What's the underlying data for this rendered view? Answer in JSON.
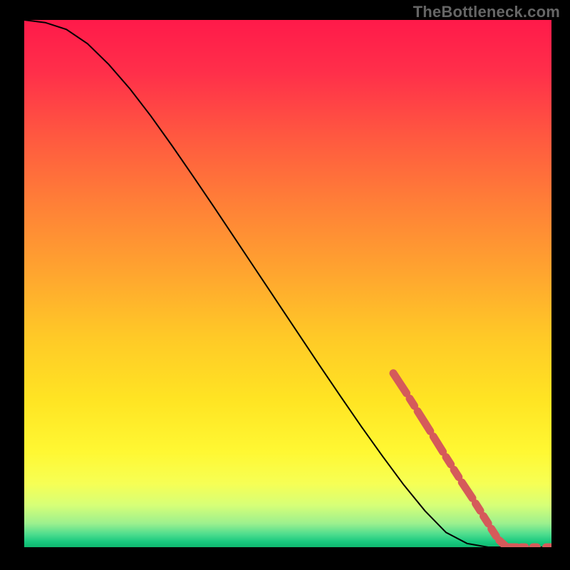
{
  "watermark": "TheBottleneck.com",
  "chart_data": {
    "type": "line",
    "title": "",
    "xlabel": "",
    "ylabel": "",
    "xlim": [
      0,
      100
    ],
    "ylim": [
      0,
      100
    ],
    "curve": {
      "description": "bottleneck curve, starts top-left, curves over, drops diagonally to bottom-right where it levels off",
      "x": [
        0,
        4,
        8,
        12,
        16,
        20,
        24,
        28,
        32,
        36,
        40,
        44,
        48,
        52,
        56,
        60,
        64,
        68,
        72,
        76,
        80,
        84,
        88,
        92,
        96,
        100
      ],
      "y": [
        100,
        99.5,
        98.2,
        95.5,
        91.6,
        87.0,
        81.8,
        76.2,
        70.4,
        64.5,
        58.5,
        52.5,
        46.5,
        40.5,
        34.5,
        28.6,
        22.8,
        17.2,
        11.8,
        6.9,
        2.8,
        0.7,
        0.0,
        0.0,
        0.0,
        0.0
      ]
    },
    "dash_segments": [
      {
        "x0": 70.0,
        "y0": 33.0,
        "x1": 72.5,
        "y1": 29.2
      },
      {
        "x0": 73.1,
        "y0": 28.2,
        "x1": 74.0,
        "y1": 26.8
      },
      {
        "x0": 74.6,
        "y0": 25.8,
        "x1": 77.0,
        "y1": 22.0
      },
      {
        "x0": 77.6,
        "y0": 21.0,
        "x1": 79.4,
        "y1": 18.1
      },
      {
        "x0": 80.0,
        "y0": 17.1,
        "x1": 80.9,
        "y1": 15.7
      },
      {
        "x0": 81.5,
        "y0": 14.7,
        "x1": 82.4,
        "y1": 13.3
      },
      {
        "x0": 83.0,
        "y0": 12.3,
        "x1": 85.0,
        "y1": 9.3
      },
      {
        "x0": 85.6,
        "y0": 8.3,
        "x1": 86.5,
        "y1": 6.9
      },
      {
        "x0": 87.1,
        "y0": 5.9,
        "x1": 88.0,
        "y1": 4.5
      },
      {
        "x0": 88.6,
        "y0": 3.5,
        "x1": 89.5,
        "y1": 2.1
      },
      {
        "x0": 90.1,
        "y0": 1.3,
        "x1": 91.3,
        "y1": 0.2
      },
      {
        "x0": 92.0,
        "y0": 0.0,
        "x1": 93.4,
        "y1": 0.0
      },
      {
        "x0": 94.3,
        "y0": 0.0,
        "x1": 95.0,
        "y1": 0.0
      },
      {
        "x0": 96.5,
        "y0": 0.0,
        "x1": 97.2,
        "y1": 0.0
      },
      {
        "x0": 99.0,
        "y0": 0.0,
        "x1": 100.0,
        "y1": 0.0
      }
    ],
    "gradient_stops": [
      {
        "offset": 0.0,
        "color": "#ff1a4a"
      },
      {
        "offset": 0.1,
        "color": "#ff2f4a"
      },
      {
        "offset": 0.22,
        "color": "#ff5840"
      },
      {
        "offset": 0.35,
        "color": "#ff8037"
      },
      {
        "offset": 0.48,
        "color": "#ffa52f"
      },
      {
        "offset": 0.6,
        "color": "#ffc927"
      },
      {
        "offset": 0.72,
        "color": "#ffe423"
      },
      {
        "offset": 0.82,
        "color": "#fff833"
      },
      {
        "offset": 0.88,
        "color": "#f6ff55"
      },
      {
        "offset": 0.92,
        "color": "#d7ff77"
      },
      {
        "offset": 0.955,
        "color": "#9cf08e"
      },
      {
        "offset": 0.975,
        "color": "#4fdd8e"
      },
      {
        "offset": 0.99,
        "color": "#18c97f"
      },
      {
        "offset": 1.0,
        "color": "#0fb86e"
      }
    ],
    "dash_color": "#d55a5a",
    "curve_color": "#000000"
  }
}
